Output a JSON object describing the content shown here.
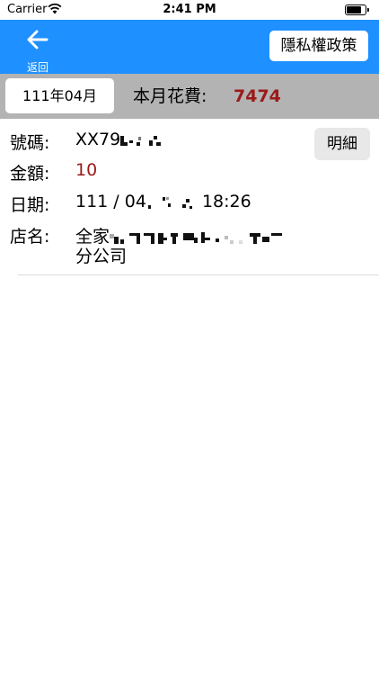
{
  "status_bar": {
    "carrier": "Carrier",
    "time": "2:41 PM"
  },
  "nav": {
    "back_label": "返回",
    "privacy_button": "隱私權政策"
  },
  "summary": {
    "month": "111年04月",
    "monthly_spend_label": "本月花費:",
    "monthly_spend_value": "7474"
  },
  "record": {
    "number_label": "號碼:",
    "number_value_visible": "XX79",
    "amount_label": "金額:",
    "amount_value": "10",
    "date_label": "日期:",
    "date_prefix": "111 / 04",
    "date_time": "18:26",
    "store_label": "店名:",
    "store_prefix": "全家",
    "store_suffix": "分公司",
    "detail_button": "明細"
  },
  "colors": {
    "nav_blue": "#1e90ff",
    "summary_gray": "#b3b3b3",
    "accent_red": "#9b1a1a"
  }
}
